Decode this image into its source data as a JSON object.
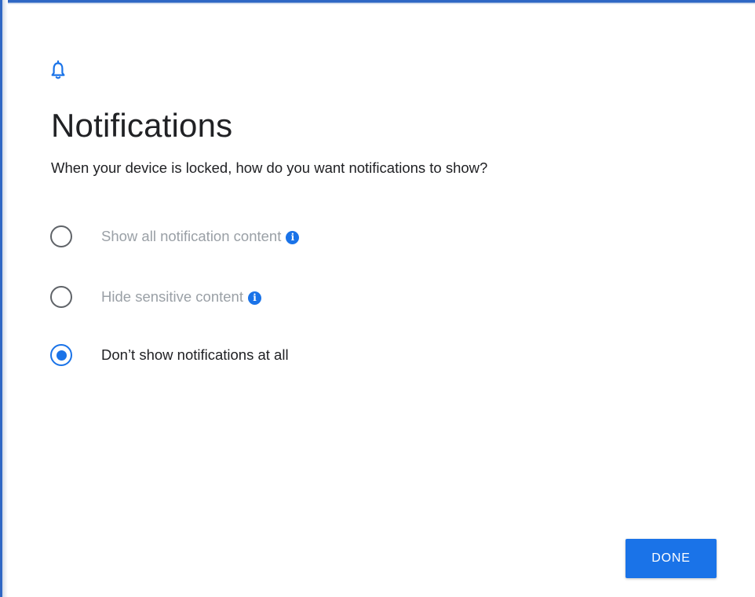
{
  "header": {
    "icon": "bell-icon",
    "title": "Notifications",
    "subtitle": "When your device is locked, how do you want notifications to show?"
  },
  "options": [
    {
      "label": "Show all notification content",
      "selected": false,
      "has_info_icon": true,
      "state": "disabled"
    },
    {
      "label": "Hide sensitive content",
      "selected": false,
      "has_info_icon": true,
      "state": "disabled"
    },
    {
      "label": "Don’t show notifications at all",
      "selected": true,
      "has_info_icon": false,
      "state": "enabled"
    }
  ],
  "footer": {
    "done_label": "DONE"
  },
  "colors": {
    "accent": "#1a73e8",
    "frame": "#2f67c4",
    "text": "#202124",
    "disabled_text": "#9aa0a6",
    "radio_unchecked": "#5f6368"
  },
  "info_glyph": "i"
}
